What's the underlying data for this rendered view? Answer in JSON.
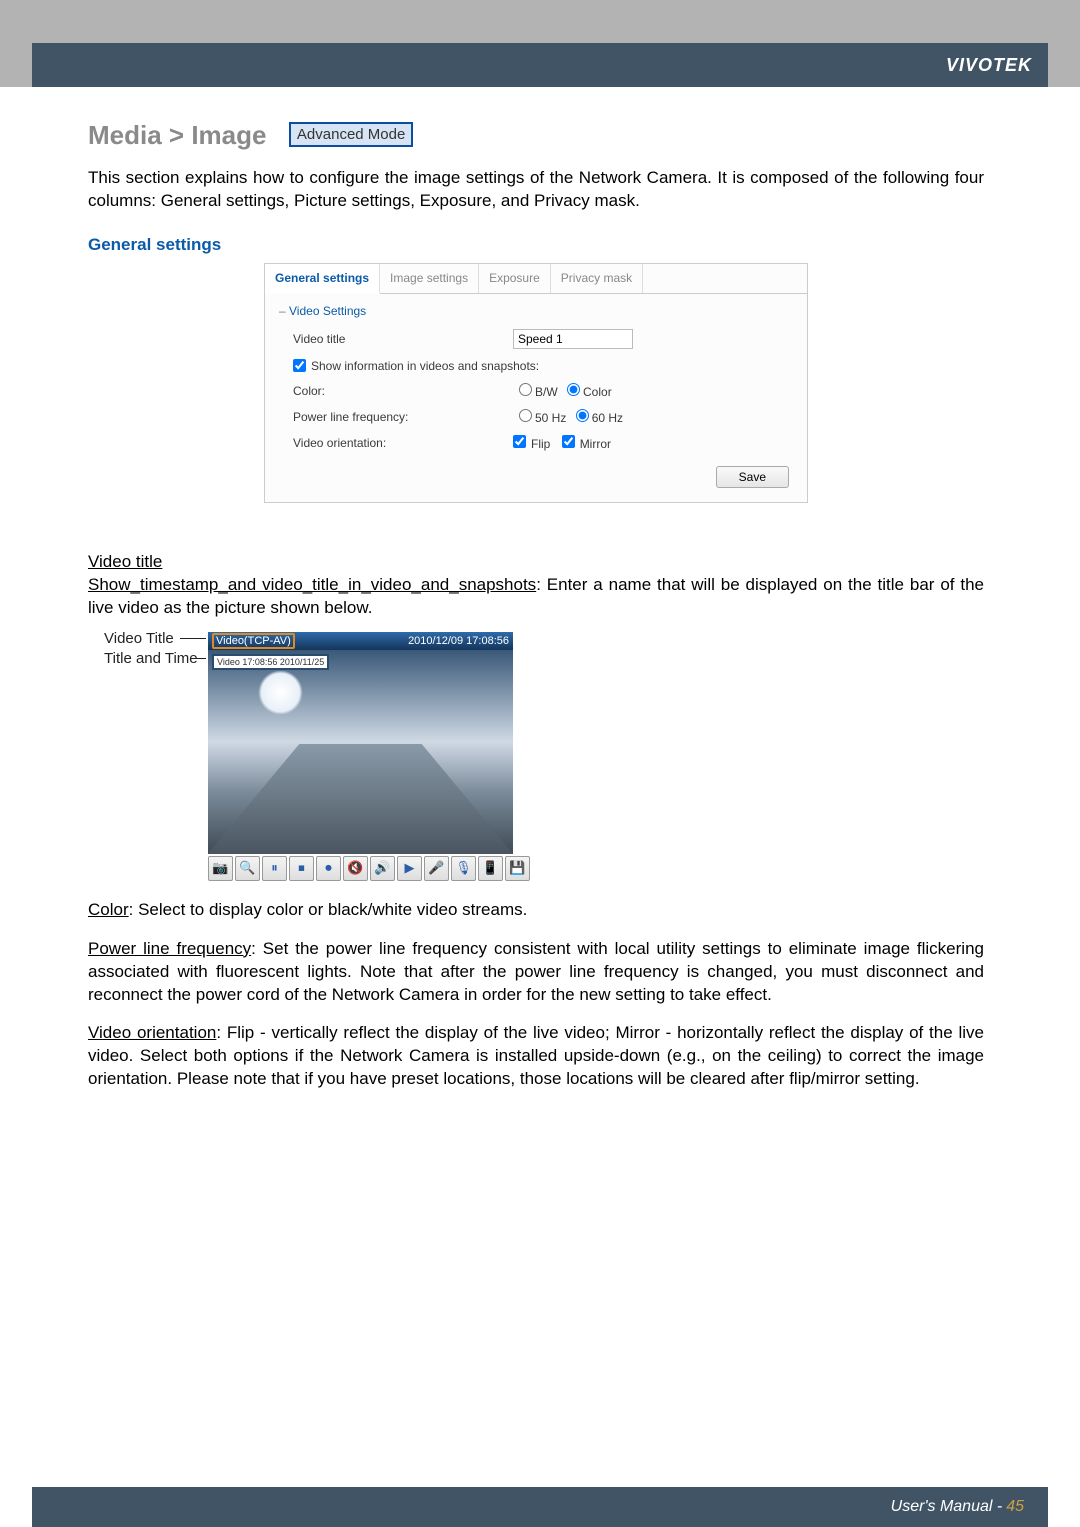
{
  "brand": "VIVOTEK",
  "page_title": "Media > Image",
  "advanced_mode": "Advanced Mode",
  "intro": "This section explains how to configure the image settings of the Network Camera. It is composed of the following four columns: General settings, Picture settings, Exposure, and Privacy mask.",
  "subhead": "General settings",
  "tabs": {
    "general": "General settings",
    "image": "Image settings",
    "exposure": "Exposure",
    "privacy": "Privacy mask"
  },
  "panel": {
    "fieldset": "Video Settings",
    "video_title_label": "Video title",
    "video_title_value": "Speed 1",
    "show_info_label": "Show information in videos and snapshots:",
    "color_label": "Color:",
    "color_bw": "B/W",
    "color_color": "Color",
    "plf_label": "Power line frequency:",
    "plf_50": "50 Hz",
    "plf_60": "60 Hz",
    "orient_label": "Video orientation:",
    "orient_flip": "Flip",
    "orient_mirror": "Mirror",
    "save": "Save"
  },
  "video": {
    "title_label": "Video Title",
    "time_label": "Title and Time",
    "bar_left": "Video(TCP-AV)",
    "bar_right": "2010/12/09  17:08:56",
    "overlay": "Video 17:08:56  2010/11/25"
  },
  "toolbar_icons": [
    "📷",
    "🔍",
    "⏸",
    "⏹",
    "⏺",
    "🔇",
    "🔊",
    "▶",
    "🎤",
    "🎙",
    "📱",
    "💾"
  ],
  "body": {
    "vt_head": "Video title",
    "vt_line1": "Show_timestamp_and video_title_in_video_and_snapshots",
    "vt_line1_rest": ": Enter a name that will be displayed on the title bar of the live video as the picture shown below.",
    "color_head": "Color",
    "color_rest": ": Select to display color or black/white video streams.",
    "plf_head": "Power line frequency",
    "plf_rest": ": Set the power line frequency consistent with local utility settings to eliminate image flickering associated with fluorescent lights. Note that after the power line frequency is changed, you must disconnect and reconnect the power cord of the Network Camera in order for the new setting to take effect.",
    "orient_head": "Video orientation",
    "orient_rest": ": Flip - vertically reflect the display of the live video; Mirror - horizontally reflect the display of the live video. Select both options if the Network Camera is installed upside-down (e.g., on the ceiling) to correct the image orientation. Please note that if you have preset locations, those locations will be cleared after flip/mirror setting."
  },
  "footer": {
    "label": "User's Manual - ",
    "page": "45"
  }
}
